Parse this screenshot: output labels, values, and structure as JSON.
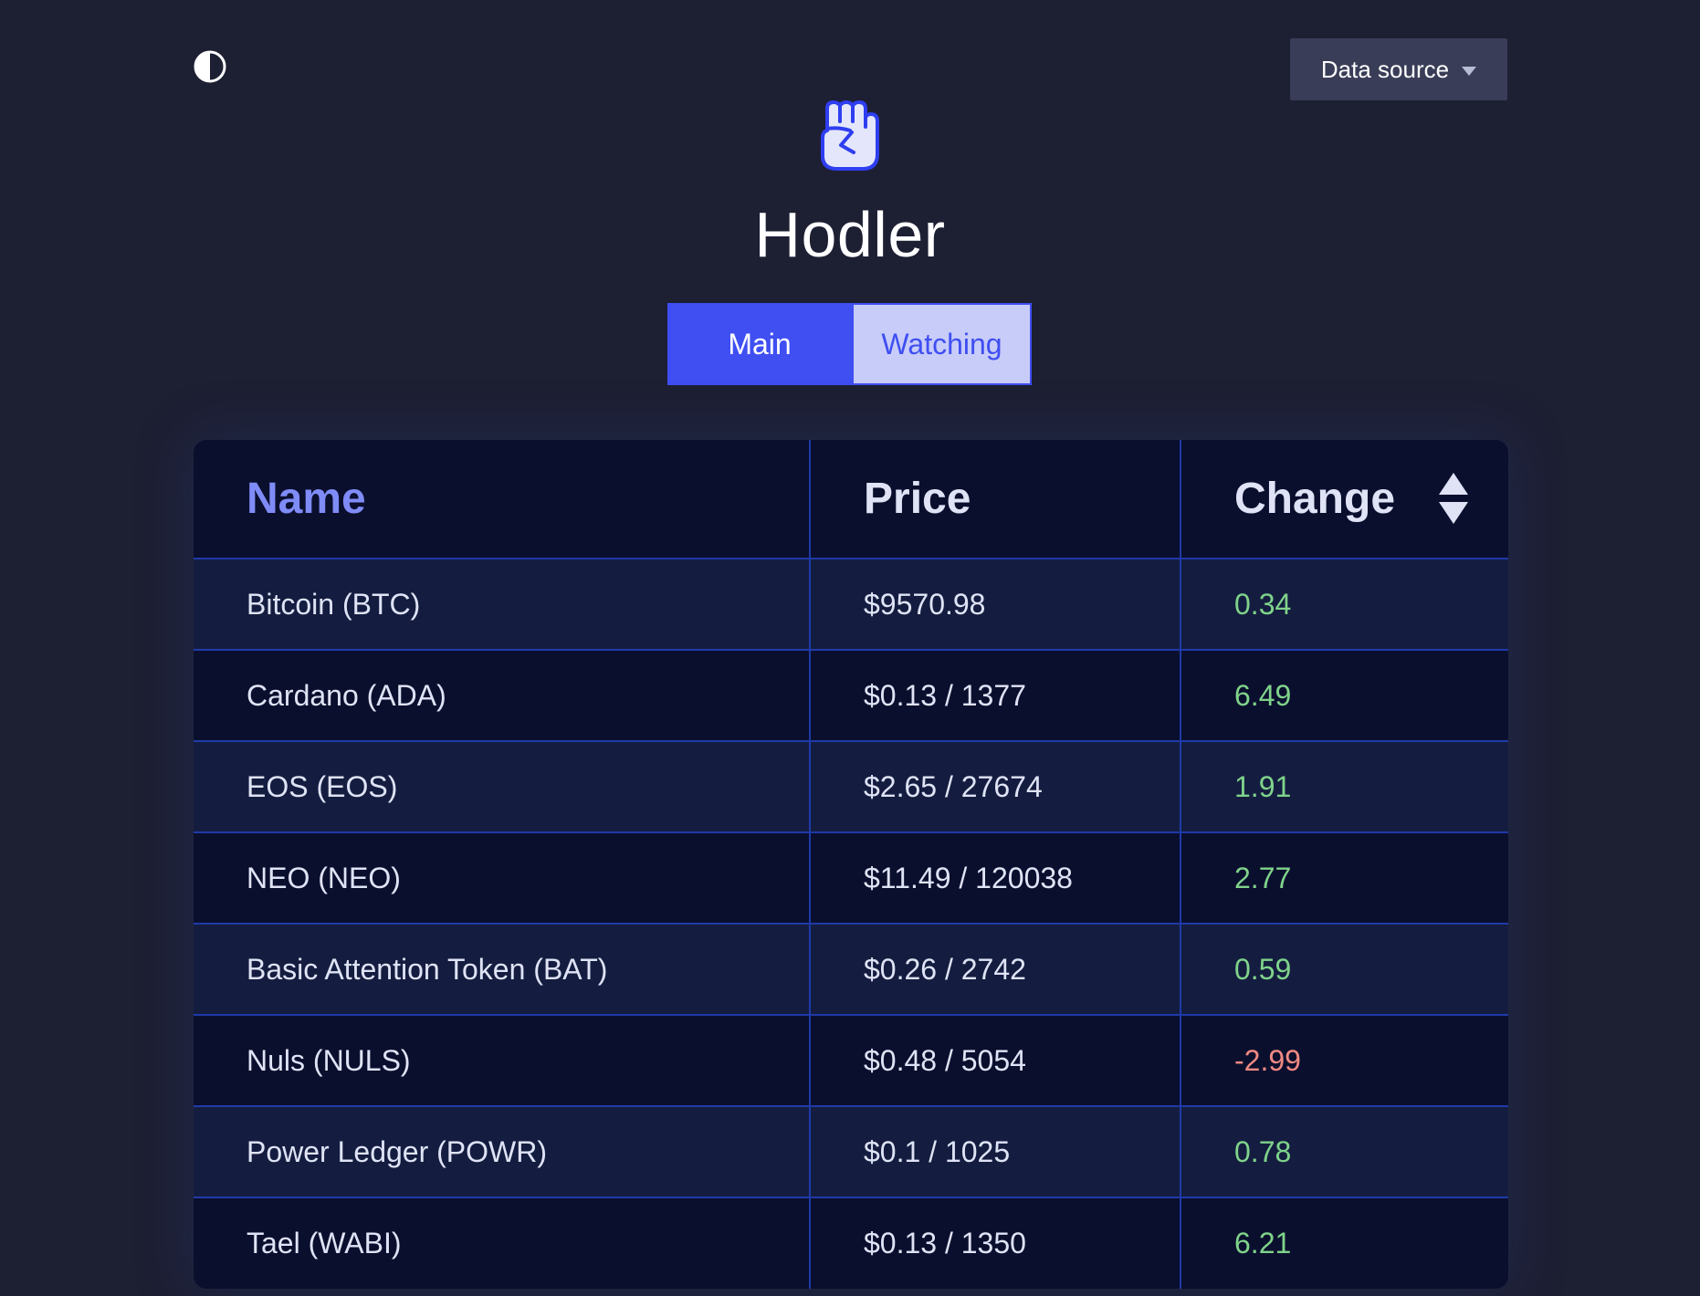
{
  "header": {
    "theme_toggle_icon": "contrast-icon",
    "data_source_label": "Data source",
    "logo_icon": "raised-fist-icon",
    "title": "Hodler"
  },
  "tabs": [
    {
      "label": "Main",
      "active": true
    },
    {
      "label": "Watching",
      "active": false
    }
  ],
  "table": {
    "columns": {
      "name": "Name",
      "price": "Price",
      "change": "Change"
    },
    "sorted_by": "change",
    "rows": [
      {
        "name": "Bitcoin (BTC)",
        "price": "$9570.98",
        "change": "0.34",
        "direction": "up"
      },
      {
        "name": "Cardano (ADA)",
        "price": "$0.13 / 1377",
        "change": "6.49",
        "direction": "up"
      },
      {
        "name": "EOS (EOS)",
        "price": "$2.65 / 27674",
        "change": "1.91",
        "direction": "up"
      },
      {
        "name": "NEO (NEO)",
        "price": "$11.49 / 120038",
        "change": "2.77",
        "direction": "up"
      },
      {
        "name": "Basic Attention Token (BAT)",
        "price": "$0.26 / 2742",
        "change": "0.59",
        "direction": "up"
      },
      {
        "name": "Nuls (NULS)",
        "price": "$0.48 / 5054",
        "change": "-2.99",
        "direction": "down"
      },
      {
        "name": "Power Ledger (POWR)",
        "price": "$0.1 / 1025",
        "change": "0.78",
        "direction": "up"
      },
      {
        "name": "Tael (WABI)",
        "price": "$0.13 / 1350",
        "change": "6.21",
        "direction": "up"
      }
    ]
  },
  "colors": {
    "background": "#1d1f33",
    "accent": "#3f4ff2",
    "positive": "#7fd38a",
    "negative": "#f08a82",
    "header_name": "#7f8cf7"
  }
}
